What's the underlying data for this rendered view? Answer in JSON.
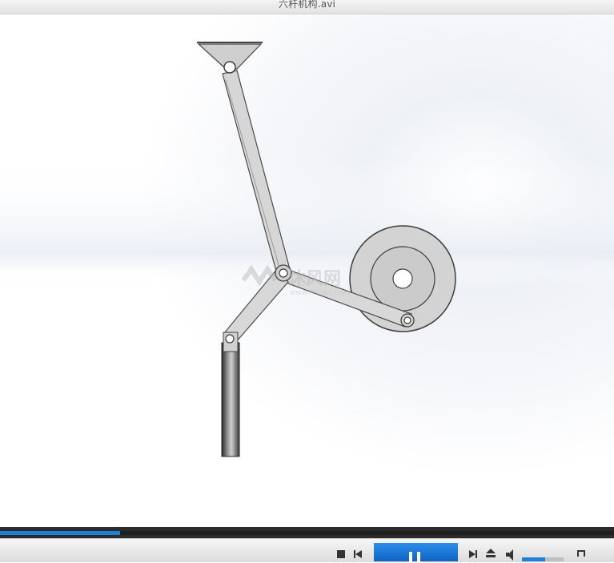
{
  "window": {
    "title": "六杆机构.avi"
  },
  "watermark": {
    "logo_text": "沐风网",
    "url_text": "www.mfcad.com"
  },
  "player": {
    "progress": 0.195,
    "volume": 0.55,
    "state": "playing"
  },
  "colors": {
    "link_fill": "#d7d7d7",
    "link_stroke": "#4a4a4a",
    "accent": "#1e7fd6",
    "seek_bg": "#2b2b2b"
  },
  "icons": {
    "stop": "stop-icon",
    "prev": "previous-icon",
    "pause": "pause-icon",
    "next": "next-icon",
    "eject": "eject-icon",
    "volume": "volume-icon",
    "fullscreen": "fullscreen-icon"
  }
}
